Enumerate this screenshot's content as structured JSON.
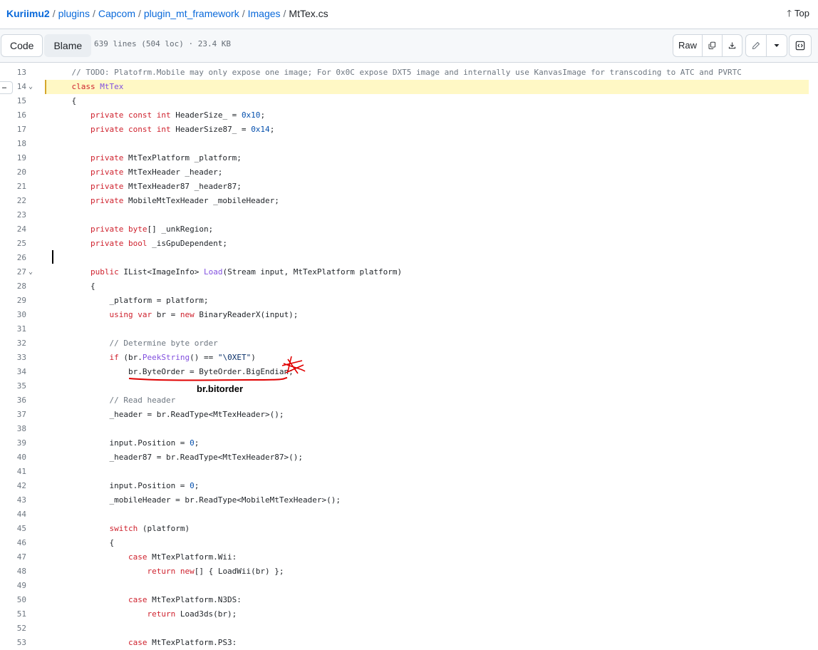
{
  "breadcrumb": {
    "repo": "Kuriimu2",
    "parts": [
      "plugins",
      "Capcom",
      "plugin_mt_framework",
      "Images"
    ],
    "file": "MtTex.cs"
  },
  "top_link": "Top",
  "toolbar": {
    "code_tab": "Code",
    "blame_tab": "Blame",
    "file_info": "639 lines (504 loc) · 23.4 KB",
    "raw_label": "Raw"
  },
  "annotation": "br.bitorder",
  "code_lines": [
    {
      "n": "13",
      "text": "    // TODO: Platofrm.Mobile may only expose one image; For 0x0C expose DXT5 image and internally use KanvasImage for transcoding to ATC and PVRTC"
    },
    {
      "n": "14",
      "text": "    class MtTex"
    },
    {
      "n": "15",
      "text": "    {"
    },
    {
      "n": "16",
      "text": "        private const int HeaderSize_ = 0x10;"
    },
    {
      "n": "17",
      "text": "        private const int HeaderSize87_ = 0x14;"
    },
    {
      "n": "18",
      "text": ""
    },
    {
      "n": "19",
      "text": "        private MtTexPlatform _platform;"
    },
    {
      "n": "20",
      "text": "        private MtTexHeader _header;"
    },
    {
      "n": "21",
      "text": "        private MtTexHeader87 _header87;"
    },
    {
      "n": "22",
      "text": "        private MobileMtTexHeader _mobileHeader;"
    },
    {
      "n": "23",
      "text": ""
    },
    {
      "n": "24",
      "text": "        private byte[] _unkRegion;"
    },
    {
      "n": "25",
      "text": "        private bool _isGpuDependent;"
    },
    {
      "n": "26",
      "text": ""
    },
    {
      "n": "27",
      "text": "        public IList<ImageInfo> Load(Stream input, MtTexPlatform platform)"
    },
    {
      "n": "28",
      "text": "        {"
    },
    {
      "n": "29",
      "text": "            _platform = platform;"
    },
    {
      "n": "30",
      "text": "            using var br = new BinaryReaderX(input);"
    },
    {
      "n": "31",
      "text": ""
    },
    {
      "n": "32",
      "text": "            // Determine byte order"
    },
    {
      "n": "33",
      "text": "            if (br.PeekString() == \"\\0XET\")"
    },
    {
      "n": "34",
      "text": "                br.ByteOrder = ByteOrder.BigEndian;"
    },
    {
      "n": "35",
      "text": ""
    },
    {
      "n": "36",
      "text": "            // Read header"
    },
    {
      "n": "37",
      "text": "            _header = br.ReadType<MtTexHeader>();"
    },
    {
      "n": "38",
      "text": ""
    },
    {
      "n": "39",
      "text": "            input.Position = 0;"
    },
    {
      "n": "40",
      "text": "            _header87 = br.ReadType<MtTexHeader87>();"
    },
    {
      "n": "41",
      "text": ""
    },
    {
      "n": "42",
      "text": "            input.Position = 0;"
    },
    {
      "n": "43",
      "text": "            _mobileHeader = br.ReadType<MobileMtTexHeader>();"
    },
    {
      "n": "44",
      "text": ""
    },
    {
      "n": "45",
      "text": "            switch (platform)"
    },
    {
      "n": "46",
      "text": "            {"
    },
    {
      "n": "47",
      "text": "                case MtTexPlatform.Wii:"
    },
    {
      "n": "48",
      "text": "                    return new[] { LoadWii(br) };"
    },
    {
      "n": "49",
      "text": ""
    },
    {
      "n": "50",
      "text": "                case MtTexPlatform.N3DS:"
    },
    {
      "n": "51",
      "text": "                    return Load3ds(br);"
    },
    {
      "n": "52",
      "text": ""
    },
    {
      "n": "53",
      "text": "                case MtTexPlatform.PS3:"
    }
  ],
  "icons": [
    "arrow-up-icon",
    "copy-icon",
    "download-icon",
    "pencil-icon",
    "triangle-down-icon",
    "code-panel-icon",
    "chevron-down-icon",
    "kebab-icon"
  ]
}
